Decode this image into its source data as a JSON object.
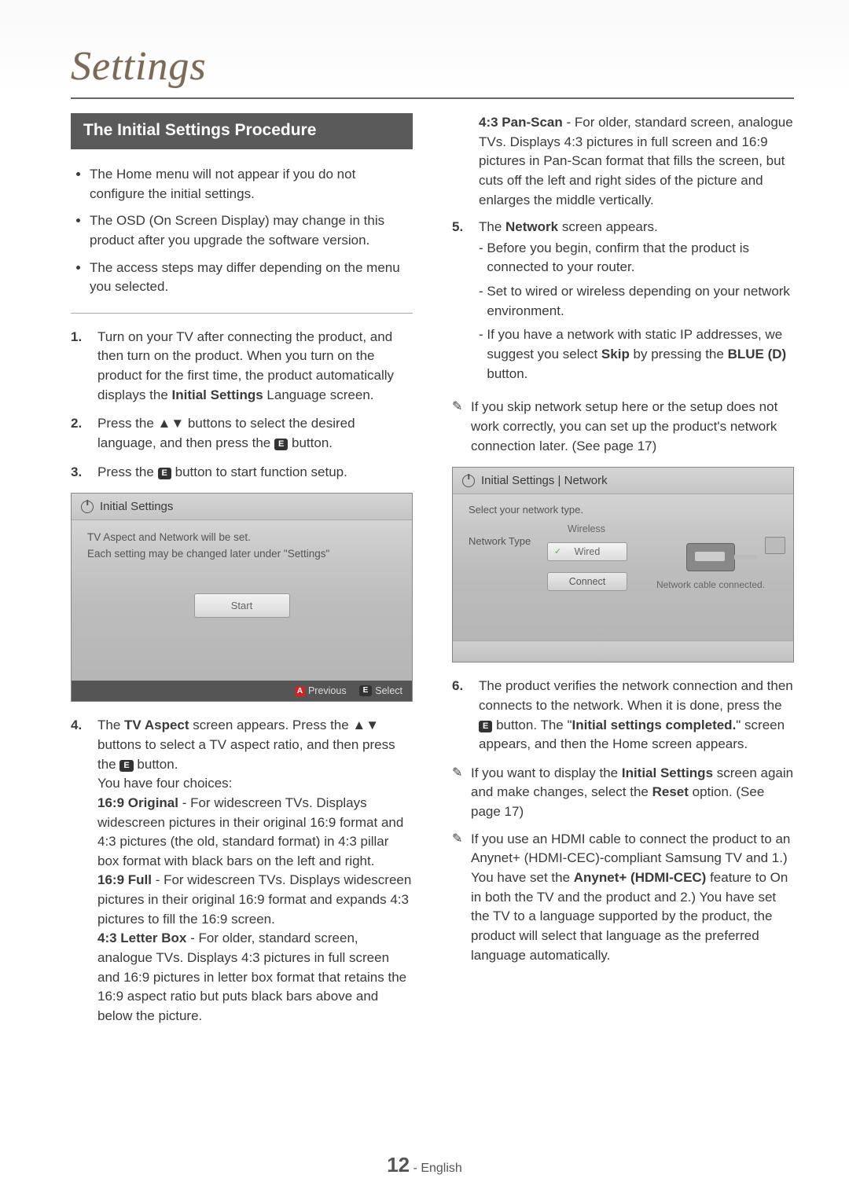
{
  "title": "Settings",
  "banner": "The Initial Settings Procedure",
  "notes": [
    "The Home menu will not appear if you do not configure the initial settings.",
    "The OSD (On Screen Display) may change in this product after you upgrade the software version.",
    "The access steps may differ depending on the menu you selected."
  ],
  "left_steps": {
    "s1": {
      "num": "1.",
      "body_a": "Turn on your TV after connecting the product, and then turn on the product. When you turn on the product for the first time, the product automatically displays the ",
      "bold": "Initial Settings",
      "body_b": " Language screen."
    },
    "s2": {
      "num": "2.",
      "body_a": "Press the ▲▼ buttons to select the desired language, and then press the ",
      "btn": "E",
      "body_b": " button."
    },
    "s3": {
      "num": "3.",
      "body_a": "Press the ",
      "btn": "E",
      "body_b": " button to start function setup."
    }
  },
  "osd_initial": {
    "header": "Initial Settings",
    "line1": "TV Aspect and Network will be set.",
    "line2": "Each setting may be changed later under \"Settings\"",
    "start": "Start",
    "footer_prev": "Previous",
    "footer_sel": "Select",
    "key_a": "A",
    "key_e": "E"
  },
  "step4": {
    "num": "4.",
    "intro_a": "The ",
    "intro_bold": "TV Aspect",
    "intro_b": " screen appears. Press the ▲▼ buttons to select a TV aspect ratio, and then press the ",
    "intro_btn": "E",
    "intro_c": " button.",
    "choices_intro": "You have four choices:",
    "c1_bold": "16:9 Original",
    "c1_body": " - For widescreen TVs. Displays widescreen pictures in their original 16:9 format and 4:3 pictures (the old, standard format) in 4:3 pillar box format with black bars on the left and right.",
    "c2_bold": "16:9 Full",
    "c2_body": " - For widescreen TVs. Displays widescreen pictures in their original 16:9 format and expands 4:3 pictures to fill the 16:9 screen.",
    "c3_bold": "4:3 Letter Box",
    "c3_body": " - For older, standard screen, analogue TVs. Displays 4:3 pictures in full screen and 16:9 pictures in letter box format that retains the 16:9 aspect ratio but puts black bars above and below the picture.",
    "c4_bold": "4:3 Pan-Scan",
    "c4_body": " - For older, standard screen, analogue TVs. Displays 4:3 pictures in full screen and 16:9 pictures in Pan-Scan format that fills the screen, but cuts off the left and right sides of the picture and enlarges the middle vertically."
  },
  "step5": {
    "num": "5.",
    "intro_a": "The ",
    "intro_bold": "Network",
    "intro_b": " screen appears.",
    "d1": "Before you begin, confirm that the product is connected to your router.",
    "d2": "Set to wired or wireless depending on your network environment.",
    "d3_a": "If you have a network with static IP addresses, we suggest you select ",
    "d3_bold1": "Skip",
    "d3_b": " by pressing the ",
    "d3_bold2": "BLUE (D)",
    "d3_c": " button."
  },
  "tip_net": "If you skip network setup here or the setup does not work correctly, you can set up the product's network connection later. (See page 17)",
  "osd_network": {
    "header": "Initial Settings | Network",
    "prompt": "Select your network type.",
    "label": "Network Type",
    "opt1": "Wireless",
    "opt2": "Wired",
    "connect": "Connect",
    "status": "Network cable connected."
  },
  "step6": {
    "num": "6.",
    "body_a": "The product verifies the network connection and then connects to the network. When it is done, press the ",
    "btn": "E",
    "body_b": " button. The \"",
    "bold": "Initial settings completed.",
    "body_c": "\" screen appears, and then the Home screen appears."
  },
  "tip_reset_a": "If you want to display the ",
  "tip_reset_bold1": "Initial Settings",
  "tip_reset_b": " screen again and make changes, select the ",
  "tip_reset_bold2": "Reset",
  "tip_reset_c": " option. (See page 17)",
  "tip_anynet_a": "If you use an HDMI cable to connect the product to an Anynet+ (HDMI-CEC)-compliant Samsung TV and 1.) You have set the ",
  "tip_anynet_bold": "Anynet+ (HDMI-CEC)",
  "tip_anynet_b": " feature to On in both the TV and the product and 2.) You have set the TV to a language supported by the product, the product will select that language as the preferred language automatically.",
  "page_number": "12",
  "page_lang": "English"
}
